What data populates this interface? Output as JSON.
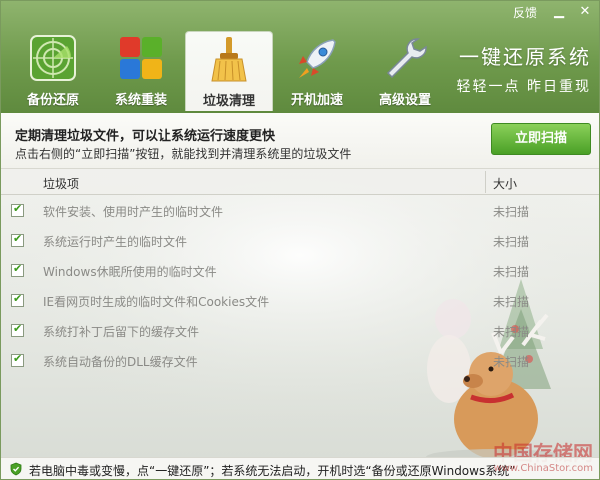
{
  "titlebar": {
    "feedback": "反馈",
    "minimize_icon": "minimize-icon",
    "close_icon": "close-icon"
  },
  "toolbar": {
    "items": [
      {
        "label": "备份还原",
        "icon": "radar-icon"
      },
      {
        "label": "系统重装",
        "icon": "windows-logo-icon"
      },
      {
        "label": "垃圾清理",
        "icon": "broom-icon",
        "active": true
      },
      {
        "label": "开机加速",
        "icon": "rocket-icon"
      },
      {
        "label": "高级设置",
        "icon": "wrench-icon"
      }
    ]
  },
  "brand": {
    "title": "一键还原系统",
    "slogan": "轻轻一点 昨日重现"
  },
  "notice": {
    "title": "定期清理垃圾文件，可以让系统运行速度更快",
    "subtitle": "点击右侧的“立即扫描”按钮，就能找到并清理系统里的垃圾文件",
    "scan_button": "立即扫描"
  },
  "table": {
    "headers": {
      "name": "垃圾项",
      "size": "大小"
    },
    "rows": [
      {
        "name": "软件安装、使用时产生的临时文件",
        "size": "未扫描",
        "checked": true
      },
      {
        "name": "系统运行时产生的临时文件",
        "size": "未扫描",
        "checked": true
      },
      {
        "name": "Windows休眠所使用的临时文件",
        "size": "未扫描",
        "checked": true
      },
      {
        "name": "IE看网页时生成的临时文件和Cookies文件",
        "size": "未扫描",
        "checked": true
      },
      {
        "name": "系统打补丁后留下的缓存文件",
        "size": "未扫描",
        "checked": true
      },
      {
        "name": "系统自动备份的DLL缓存文件",
        "size": "未扫描",
        "checked": true
      }
    ]
  },
  "status": {
    "text": "若电脑中毒或变慢，点“一键还原”；若系统无法启动，开机时选“备份或还原Windows系统”"
  },
  "watermark": {
    "main": "中国存储网",
    "url": "www.ChinaStor.com"
  },
  "colors": {
    "header_green": "#6f9a4c",
    "scan_button_green": "#4aa026",
    "check_green": "#3a9a1a"
  }
}
